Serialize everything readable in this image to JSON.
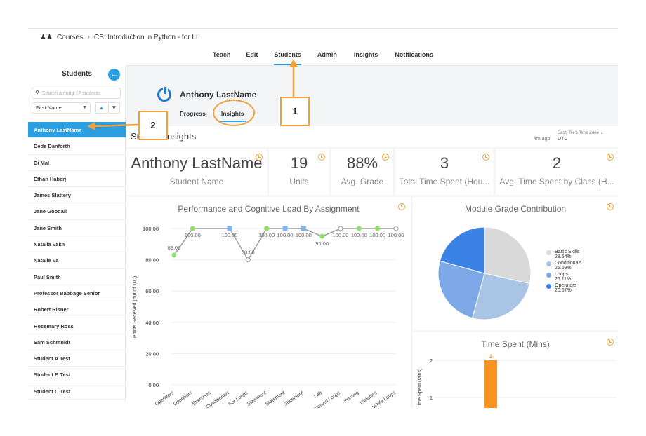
{
  "breadcrumb": {
    "items": [
      "Courses",
      "CS: Introduction in Python - for LI"
    ]
  },
  "topnav": {
    "tabs": [
      "Teach",
      "Edit",
      "Students",
      "Admin",
      "Insights",
      "Notifications"
    ],
    "active": "Students"
  },
  "sidebar": {
    "title": "Students",
    "search_placeholder": "Search among 17 students",
    "sort_value": "First Name",
    "students": [
      "Anthony LastName",
      "Dede Danforth",
      "Di Mal",
      "Ethan Haberj",
      "James Slattery",
      "Jane Goodall",
      "Jane Smith",
      "Natalia Vakh",
      "Natalie Va",
      "Paul Smith",
      "Professor Babbage Senior",
      "Robert Risner",
      "Rosemary Ross",
      "Sam Schmnidt",
      "Student A Test",
      "Student B Test",
      "Student C Test"
    ],
    "active_student": "Anthony LastName"
  },
  "student": {
    "name": "Anthony LastName",
    "subtabs": [
      "Progress",
      "Insights"
    ],
    "active_subtab": "Insights"
  },
  "page": {
    "title": "Student Insights",
    "tz_label": "Each Tile's Time Zone",
    "tz_ago": "4m ago",
    "tz_value": "UTC"
  },
  "kpis": [
    {
      "value": "Anthony LastName",
      "label": "Student Name"
    },
    {
      "value": "19",
      "label": "Units"
    },
    {
      "value": "88%",
      "label": "Avg. Grade"
    },
    {
      "value": "3",
      "label": "Total Time Spent (Hou..."
    },
    {
      "value": "2",
      "label": "Avg. Time Spent by Class (H..."
    }
  ],
  "annotations": {
    "label1": "1",
    "label2": "2"
  },
  "colors": {
    "accent": "#2d9fe0",
    "annotation": "#f0a13a",
    "line": "#9e9e9e"
  },
  "chart_data": [
    {
      "type": "line",
      "title": "Performance and Cognitive Load By Assignment",
      "ylabel": "Points Received (out of 100)",
      "ylim": [
        0,
        100
      ],
      "yticks": [
        "0.00",
        "20.00",
        "40.00",
        "60.00",
        "80.00",
        "100.00"
      ],
      "categories": [
        "Operators",
        "Operators",
        "Exercises",
        "Conditionals",
        "For Loops",
        "Statement",
        "Statement",
        "Statement",
        "Lab",
        "Nested Loops",
        "Printing",
        "Variables",
        "While Loops"
      ],
      "series": [
        {
          "values": [
            83,
            100,
            null,
            100,
            80,
            100,
            100,
            100,
            95,
            100,
            100,
            100,
            100
          ],
          "labels": [
            "83.00",
            "100.00",
            "",
            "100.00",
            "80.00",
            "100.00",
            "100.00",
            "100.00",
            "95.00",
            "100.00",
            "100.00",
            "100.00",
            "100.00"
          ],
          "marker_colors": [
            "#8ee06a",
            "#8ee06a",
            "",
            "#7fb3ec",
            "#ffffff",
            "#8ee06a",
            "#7fb3ec",
            "#7fb3ec",
            "#8ee06a",
            "#ffffff",
            "#8ee06a",
            "#8ee06a",
            "#ffffff"
          ]
        }
      ]
    },
    {
      "type": "pie",
      "title": "Module Grade Contribution",
      "slices": [
        {
          "label": "Basic Skills",
          "value": 28.54,
          "display": "28.54%",
          "color": "#d9d9d9"
        },
        {
          "label": "Conditionals",
          "value": 25.68,
          "display": "25.68%",
          "color": "#aac4e6"
        },
        {
          "label": "Loops",
          "value": 25.11,
          "display": "25.11%",
          "color": "#7ea9e9"
        },
        {
          "label": "Operators",
          "value": 20.67,
          "display": "20.67%",
          "color": "#3b82e6"
        }
      ]
    },
    {
      "type": "bar",
      "title": "Time Spent (Mins)",
      "ylabel": "Time Spent (Mins)",
      "yticks": [
        "1",
        "2"
      ],
      "values": [
        2
      ],
      "labels": [
        "2"
      ],
      "color": "#f7931e"
    }
  ]
}
